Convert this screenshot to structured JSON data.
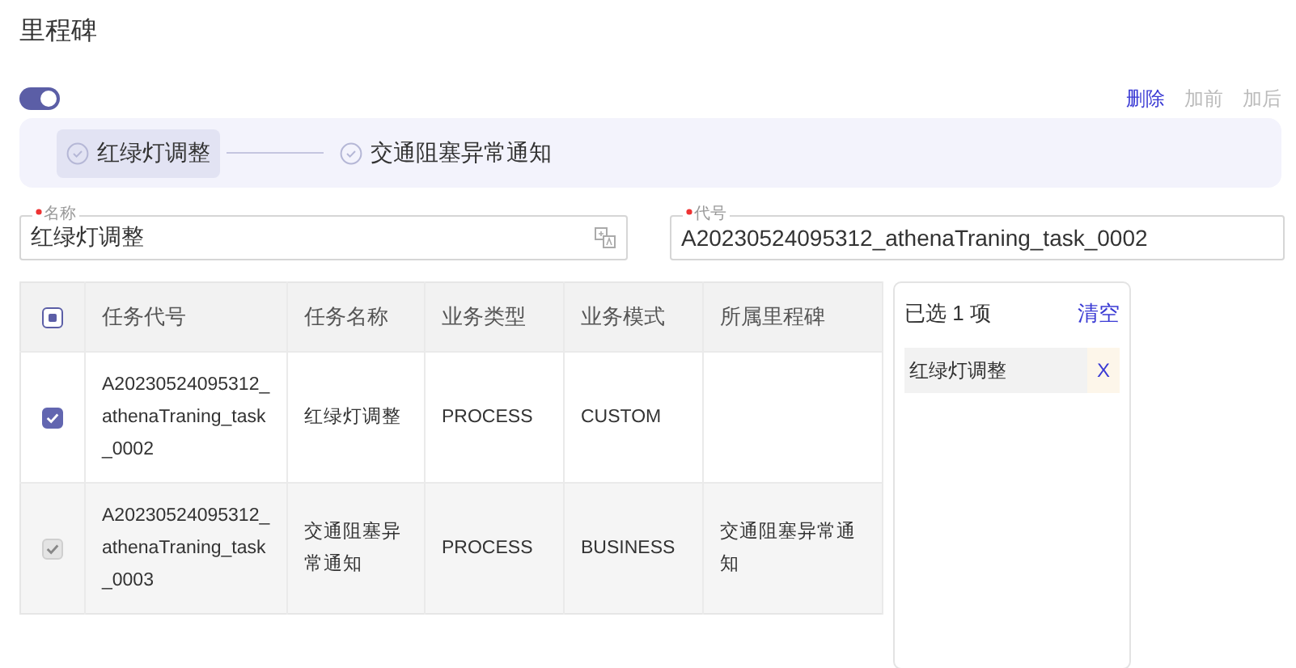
{
  "title": "里程碑",
  "toggle": {
    "on": true
  },
  "actions": [
    {
      "label": "删除",
      "disabled": false
    },
    {
      "label": "加前",
      "disabled": true
    },
    {
      "label": "加后",
      "disabled": true
    }
  ],
  "steps": [
    {
      "label": "红绿灯调整",
      "selected": true
    },
    {
      "label": "交通阻塞异常通知",
      "selected": false
    }
  ],
  "fields": [
    {
      "label": "名称",
      "required": true,
      "value": "红绿灯调整",
      "translate": true
    },
    {
      "label": "代号",
      "required": true,
      "value": "A20230524095312_athenaTraning_task_0002",
      "translate": false
    }
  ],
  "table": {
    "header_checkbox": {
      "indeterminate": true
    },
    "columns": [
      "任务代号",
      "任务名称",
      "业务类型",
      "业务模式",
      "所属里程碑"
    ],
    "rows": [
      {
        "checked": true,
        "disabled": false,
        "cells": [
          "A20230524095312_athenaTraning_task_0002",
          "红绿灯调整",
          "PROCESS",
          "CUSTOM",
          ""
        ]
      },
      {
        "checked": true,
        "disabled": true,
        "cells": [
          "A20230524095312_athenaTraning_task_0003",
          "交通阻塞异常通知",
          "PROCESS",
          "BUSINESS",
          "交通阻塞异常通知"
        ]
      }
    ]
  },
  "selection": {
    "summary": "已选 1 项",
    "clear": "清空",
    "items": [
      {
        "label": "红绿灯调整",
        "remove": "X"
      }
    ]
  }
}
